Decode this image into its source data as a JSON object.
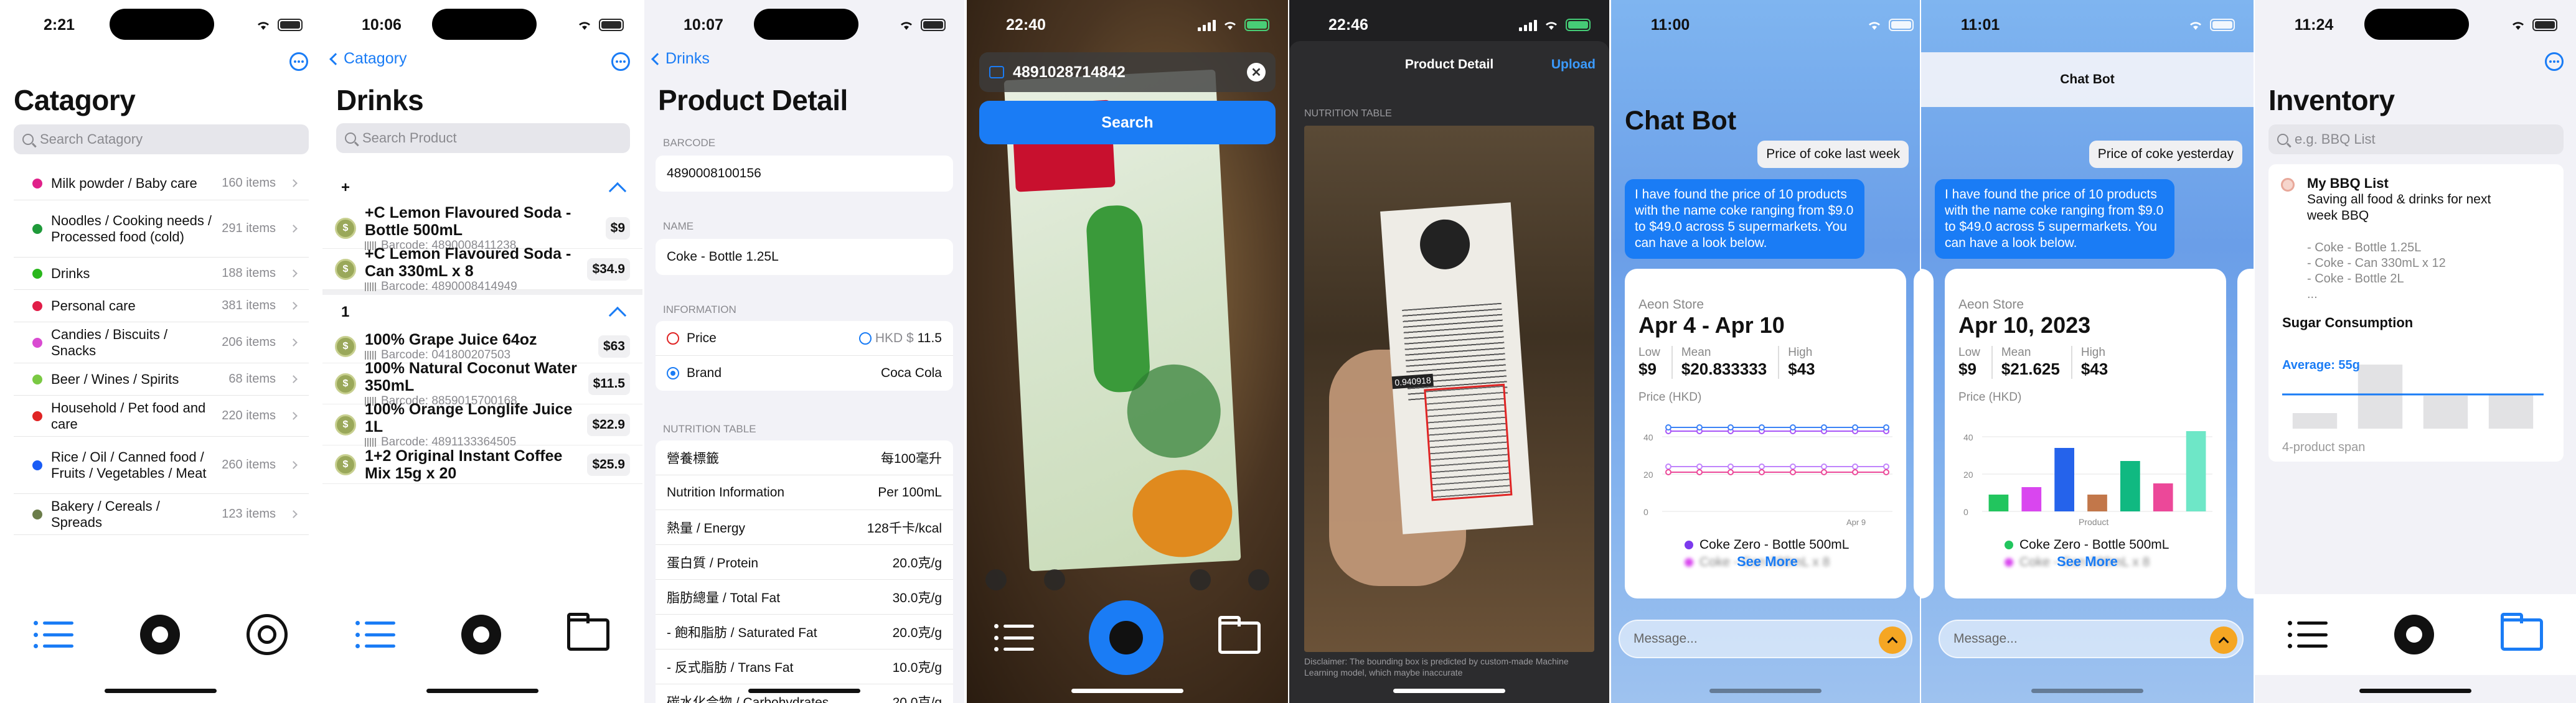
{
  "screens": {
    "categories": {
      "time": "2:21",
      "title": "Catagory",
      "search_placeholder": "Search Catagory",
      "items": [
        {
          "name": "Milk powder / Baby care",
          "count": "160 items",
          "color": "#e0218a"
        },
        {
          "name": "Noodles / Cooking needs / Processed food (cold)",
          "count": "291 items",
          "color": "#1f9a3a"
        },
        {
          "name": "Drinks",
          "count": "188 items",
          "color": "#29b71c"
        },
        {
          "name": "Personal care",
          "count": "381 items",
          "color": "#e11d48"
        },
        {
          "name": "Candies / Biscuits / Snacks",
          "count": "206 items",
          "color": "#d94bd1"
        },
        {
          "name": "Beer / Wines / Spirits",
          "count": "68 items",
          "color": "#7ac943"
        },
        {
          "name": "Household / Pet food and care",
          "count": "220 items",
          "color": "#e02424"
        },
        {
          "name": "Rice / Oil / Canned food / Fruits / Vegetables / Meat",
          "count": "260 items",
          "color": "#1a5cf5"
        },
        {
          "name": "Bakery / Cereals / Spreads",
          "count": "123 items",
          "color": "#6b7d4a"
        }
      ]
    },
    "drinks": {
      "time": "10:06",
      "back": "Catagory",
      "title": "Drinks",
      "search_placeholder": "Search Product",
      "sections": [
        {
          "header": "+",
          "products": [
            {
              "name": "+C Lemon Flavoured Soda - Bottle 500mL",
              "barcode": "Barcode: 4890008411238",
              "price": "$9"
            },
            {
              "name": "+C Lemon Flavoured Soda - Can 330mL x 8",
              "barcode": "Barcode: 4890008414949",
              "price": "$34.9"
            }
          ]
        },
        {
          "header": "1",
          "products": [
            {
              "name": "100% Grape Juice 64oz",
              "barcode": "Barcode: 041800207503",
              "price": "$63"
            },
            {
              "name": "100% Natural Coconut Water 350mL",
              "barcode": "Barcode: 8859015700168",
              "price": "$11.5"
            },
            {
              "name": "100% Orange Longlife Juice 1L",
              "barcode": "Barcode: 4891133364505",
              "price": "$22.9"
            },
            {
              "name": "1+2 Original Instant Coffee Mix 15g x 20",
              "barcode": "",
              "price": "$25.9"
            }
          ]
        }
      ]
    },
    "product_detail": {
      "time": "10:07",
      "back": "Drinks",
      "title": "Product Detail",
      "barcode_label": "BARCODE",
      "barcode": "4890008100156",
      "name_label": "NAME",
      "name": "Coke - Bottle 1.25L",
      "info_label": "INFORMATION",
      "price_label": "Price",
      "price_currency": "HKD $",
      "price_value": "11.5",
      "brand_label": "Brand",
      "brand": "Coca Cola",
      "nutrition_label": "NUTRITION TABLE",
      "nutrition": [
        {
          "k": "營養標籤",
          "v": "每100毫升"
        },
        {
          "k": "Nutrition Information",
          "v": "Per 100mL"
        },
        {
          "k": "熱量 / Energy",
          "v": "128千卡/kcal"
        },
        {
          "k": "蛋白質 / Protein",
          "v": "20.0克/g"
        },
        {
          "k": "脂肪總量 / Total Fat",
          "v": "30.0克/g"
        },
        {
          "k": "- 飽和脂肪 / Saturated Fat",
          "v": "20.0克/g"
        },
        {
          "k": "- 反式脂肪 / Trans Fat",
          "v": "10.0克/g"
        },
        {
          "k": "碳水化合物 / Carbohydrates",
          "v": "20.0克/g"
        }
      ]
    },
    "scanner": {
      "time": "22:40",
      "code": "4891028714842",
      "search_label": "Search"
    },
    "nutrition_scan": {
      "time": "22:46",
      "title": "Product Detail",
      "upload": "Upload",
      "label": "NUTRITION TABLE",
      "confidence": "0.940918",
      "disclaimer": "Disclaimer: The bounding box is predicted by custom-made Machine Learning model, which maybe inaccurate"
    },
    "chatbot1": {
      "time": "11:00",
      "title": "Chat Bot",
      "user_msg": "Price of coke last week",
      "bot_msg": "I have found the price of 10 products with the name coke ranging from $9.0 to $49.0 across 5 supermarkets. You can have a look below.",
      "store": "Aeon Store",
      "date": "Apr 4 - Apr 10",
      "low_label": "Low",
      "low": "$9",
      "mean_label": "Mean",
      "mean": "$20.833333",
      "high_label": "High",
      "high": "$43",
      "axis_label": "Price (HKD)",
      "ticks": [
        "40",
        "20",
        "0"
      ],
      "x_tick": "Apr 9",
      "legend": "Coke Zero - Bottle 500mL",
      "legend_blur1": "Coke - Can 330mL x 8",
      "legend_blur2": "Coke - Bottle 1.25L",
      "see_more": "See More",
      "placeholder": "Message..."
    },
    "chatbot2": {
      "time": "11:01",
      "title": "Chat Bot",
      "user_msg": "Price of coke yesterday",
      "bot_msg": "I have found the price of 10 products with the name coke ranging from $9.0 to $49.0 across 5 supermarkets. You can have a look below.",
      "store": "Aeon Store",
      "date": "Apr 10, 2023",
      "low_label": "Low",
      "low": "$9",
      "mean_label": "Mean",
      "mean": "$21.625",
      "high_label": "High",
      "high": "$43",
      "axis_label": "Price (HKD)",
      "ticks": [
        "40",
        "20",
        "0"
      ],
      "x_label": "Product",
      "legend": "Coke Zero - Bottle 500mL",
      "legend_blur1": "Coke - Can 330mL x 8",
      "legend_blur2": "Coke - Bottle 1.25L",
      "see_more": "See More",
      "placeholder": "Message..."
    },
    "inventory": {
      "time": "11:24",
      "title": "Inventory",
      "search_placeholder": "e.g. BBQ List",
      "list_title": "My BBQ List",
      "list_desc": "Saving all food & drinks for next week BBQ",
      "list_items": [
        "- Coke - Bottle 1.25L",
        "- Coke - Can 330mL x 12",
        "- Coke - Bottle 2L",
        "..."
      ],
      "chart_title": "Sugar Consumption",
      "average": "Average: 55g",
      "span": "4-product span"
    }
  },
  "chart_data": [
    {
      "type": "line",
      "title": "",
      "ylabel": "Price (HKD)",
      "x": [
        "",
        "",
        "",
        "",
        "",
        "",
        "Apr 9",
        ""
      ],
      "ylim": [
        0,
        50
      ],
      "series": [
        {
          "name": "Coke Zero - Bottle 500mL",
          "values": [
            43,
            43,
            43,
            43,
            43,
            43,
            43,
            43
          ]
        },
        {
          "name": "Coke - Can 330mL x 8",
          "values": [
            45,
            45,
            45,
            45,
            45,
            45,
            45,
            45
          ]
        },
        {
          "name": "Coke - Bottle 1.25L",
          "values": [
            24,
            24,
            24,
            24,
            24,
            24,
            24,
            24
          ]
        },
        {
          "name": "",
          "values": [
            21,
            21,
            21,
            21,
            21,
            21,
            21,
            21
          ]
        }
      ]
    },
    {
      "type": "bar",
      "title": "",
      "ylabel": "Price (HKD)",
      "xlabel": "Product",
      "categories": [
        "",
        "",
        "",
        "",
        "",
        "",
        ""
      ],
      "ylim": [
        0,
        50
      ],
      "values": [
        9,
        13,
        34,
        9,
        27,
        15,
        43
      ],
      "colors": [
        "#22c55e",
        "#d946ef",
        "#2563eb",
        "#c2774a",
        "#10b981",
        "#ec4899",
        "#6ee7c7"
      ]
    },
    {
      "type": "bar",
      "title": "Sugar Consumption",
      "categories": [
        "",
        "",
        "",
        ""
      ],
      "values": [
        25,
        103,
        53,
        55
      ],
      "average": 55
    }
  ]
}
